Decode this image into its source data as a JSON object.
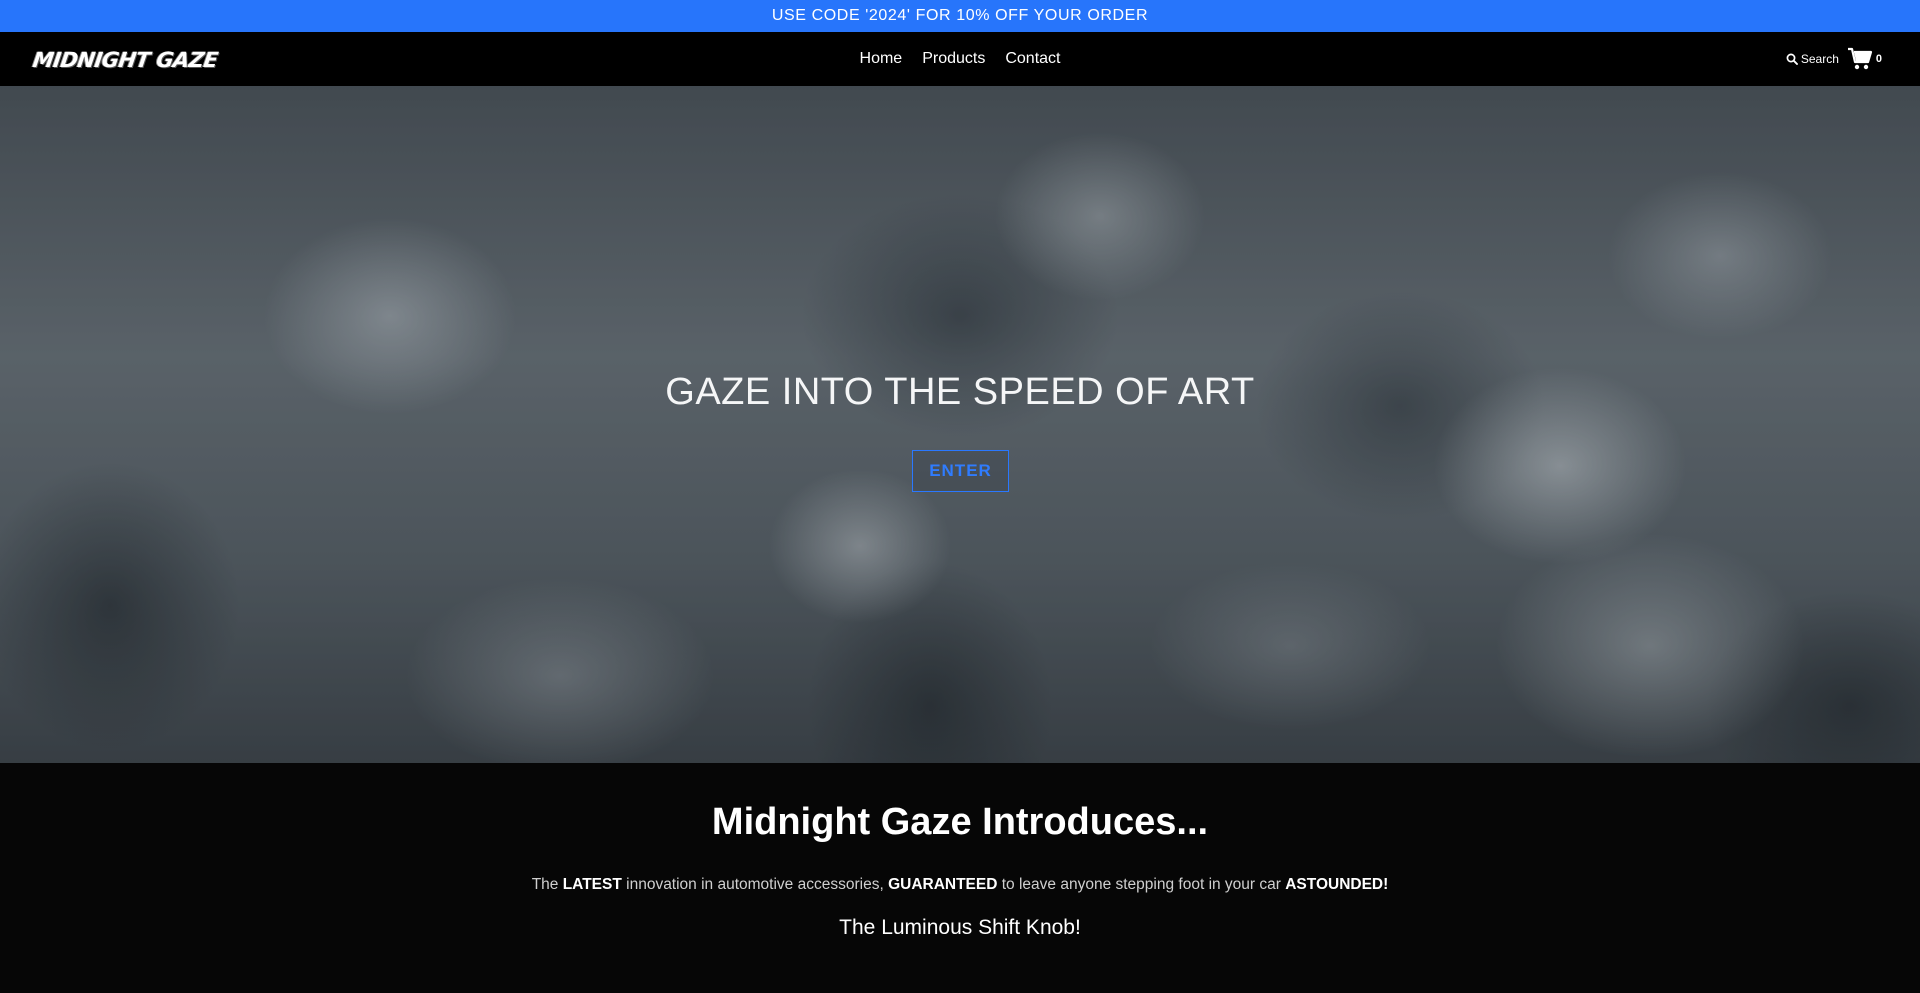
{
  "announcement": {
    "text": "USE CODE '2024' FOR 10% OFF YOUR ORDER"
  },
  "header": {
    "logo_text": "MIDNIGHT GAZE",
    "nav": [
      {
        "label": "Home"
      },
      {
        "label": "Products"
      },
      {
        "label": "Contact"
      }
    ],
    "search_label": "Search",
    "cart_count": "0"
  },
  "hero": {
    "title": "GAZE INTO THE SPEED OF ART",
    "button_label": "ENTER"
  },
  "intro": {
    "heading": "Midnight Gaze Introduces...",
    "text_parts": {
      "p1": "The ",
      "b1": "LATEST",
      "p2": " innovation in automotive accessories, ",
      "b2": "GUARANTEED",
      "p3": " to leave anyone stepping foot in your car ",
      "b3": "ASTOUNDED!"
    },
    "subheading": "The Luminous Shift Knob!"
  },
  "colors": {
    "accent": "#2775fb",
    "background": "#060606",
    "nav_background": "#000000"
  }
}
